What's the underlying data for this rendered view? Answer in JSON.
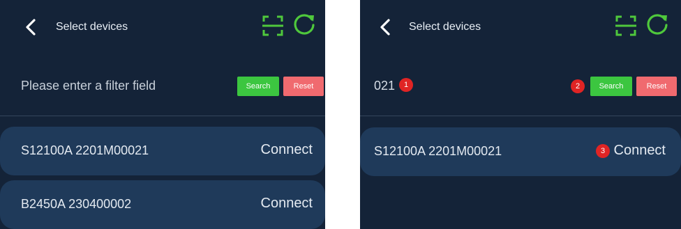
{
  "screens": [
    {
      "header": {
        "title": "Select devices"
      },
      "filter": {
        "value": "",
        "placeholder": "Please enter a filter field",
        "search_label": "Search",
        "reset_label": "Reset"
      },
      "devices": [
        {
          "name": "S12100A 2201M00021",
          "action": "Connect"
        },
        {
          "name": "B2450A 230400002",
          "action": "Connect"
        }
      ]
    },
    {
      "header": {
        "title": "Select devices"
      },
      "filter": {
        "value": "021",
        "placeholder": "Please enter a filter field",
        "search_label": "Search",
        "reset_label": "Reset"
      },
      "devices": [
        {
          "name": "S12100A 2201M00021",
          "action": "Connect"
        }
      ],
      "markers": [
        "1",
        "2",
        "3"
      ]
    }
  ],
  "colors": {
    "background": "#142338",
    "row": "#1f3a5a",
    "search": "#3cc640",
    "reset": "#f06a6f",
    "accent_icon": "#4fc83c",
    "marker": "#e02424"
  },
  "icons": [
    "back-chevron-icon",
    "scan-icon",
    "refresh-icon"
  ]
}
